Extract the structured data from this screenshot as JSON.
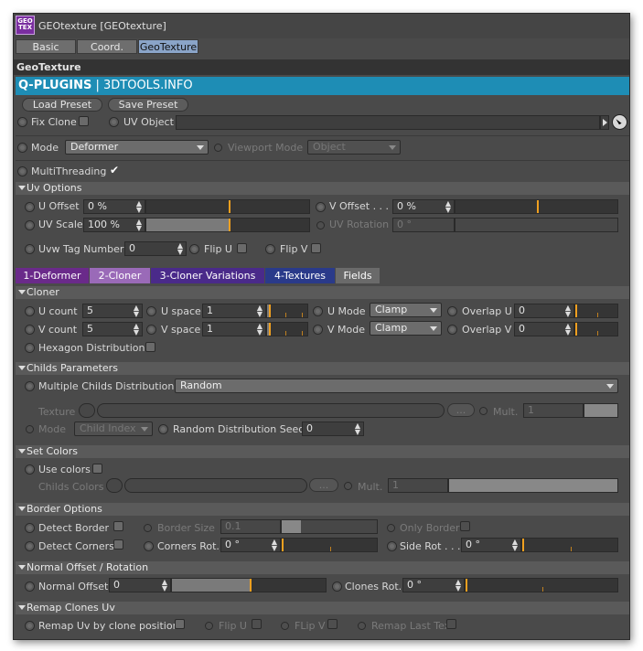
{
  "window": {
    "title": "GEOtexture [GEOtexture]",
    "logo_text": "GEO TEX"
  },
  "top_tabs": [
    {
      "label": "Basic"
    },
    {
      "label": "Coord."
    },
    {
      "label": "GeoTexture"
    }
  ],
  "section": {
    "title": "GeoTexture"
  },
  "banner": {
    "brand": "Q-PLUGINS",
    "site": " | 3DTOOLS.INFO"
  },
  "buttons": {
    "load_preset": "Load Preset",
    "save_preset": "Save Preset",
    "browse": "..."
  },
  "main": {
    "fix_clone": "Fix Clone",
    "uv_object": "UV Object",
    "mode_label": "Mode",
    "mode_value": "Deformer",
    "viewport_mode_label": "Viewport Mode",
    "viewport_mode_value": "Object",
    "multithreading": "MultiThreading",
    "multithreading_check": "✔"
  },
  "uv_options": {
    "header": "Uv Options",
    "u_offset_label": "U Offset",
    "u_offset_value": "0 %",
    "v_offset_label": "V Offset . . .",
    "v_offset_value": "0 %",
    "uv_scale_label": "UV Scale",
    "uv_scale_value": "100 %",
    "uv_rotation_label": "UV Rotation",
    "uv_rotation_value": "0 °",
    "uvw_tag_label": "Uvw Tag Number",
    "uvw_tag_value": "0",
    "flip_u": "Flip U",
    "flip_v": "Flip V"
  },
  "cloner_tabs": [
    {
      "label": "1-Deformer",
      "color": "#6a2a8a"
    },
    {
      "label": "2-Cloner",
      "color": "#9a6ab8"
    },
    {
      "label": "3-Cloner Variations",
      "color": "#4a2a8a"
    },
    {
      "label": "4-Textures",
      "color": "#2a3a8a"
    },
    {
      "label": "Fields",
      "color": "#6a6a6a"
    }
  ],
  "cloner": {
    "header": "Cloner",
    "u_count_label": "U count",
    "u_count_value": "5",
    "u_space_label": "U space",
    "u_space_value": "1",
    "u_mode_label": "U Mode",
    "u_mode_value": "Clamp",
    "overlap_u_label": "Overlap U",
    "overlap_u_value": "0",
    "v_count_label": "V count",
    "v_count_value": "5",
    "v_space_label": "V space",
    "v_space_value": "1",
    "v_mode_label": "V Mode",
    "v_mode_value": "Clamp",
    "overlap_v_label": "Overlap V",
    "overlap_v_value": "0",
    "hexagon": "Hexagon Distribution"
  },
  "childs": {
    "header": "Childs Parameters",
    "multiple_label": "Multiple Childs Distribution",
    "multiple_value": "Random",
    "texture_label": "Texture",
    "mult_label": "Mult.",
    "mult_value": "1",
    "mode_label": "Mode",
    "mode_value": "Child Index",
    "seed_label": "Random Distribution Seed",
    "seed_value": "0"
  },
  "set_colors": {
    "header": "Set Colors",
    "use_colors": "Use colors",
    "childs_colors": "Childs Colors",
    "mult_label": "Mult.",
    "mult_value": "1"
  },
  "border": {
    "header": "Border Options",
    "detect_border": "Detect Border",
    "border_size_label": "Border Size",
    "border_size_value": "0.1",
    "only_border": "Only Border",
    "detect_corners": "Detect Corners",
    "corners_rot_label": "Corners Rot.",
    "corners_rot_value": "0 °",
    "side_rot_label": "Side Rot . . .",
    "side_rot_value": "0 °"
  },
  "normal": {
    "header": "Normal Offset / Rotation",
    "offset_label": "Normal Offset",
    "offset_value": "0",
    "clones_rot_label": "Clones Rot.",
    "clones_rot_value": "0 °"
  },
  "remap": {
    "header": "Remap Clones Uv",
    "remap_label": "Remap Uv by clone position",
    "flip_u": "Flip U",
    "flip_v": "FLip V",
    "remap_last": "Remap Last Tex"
  }
}
